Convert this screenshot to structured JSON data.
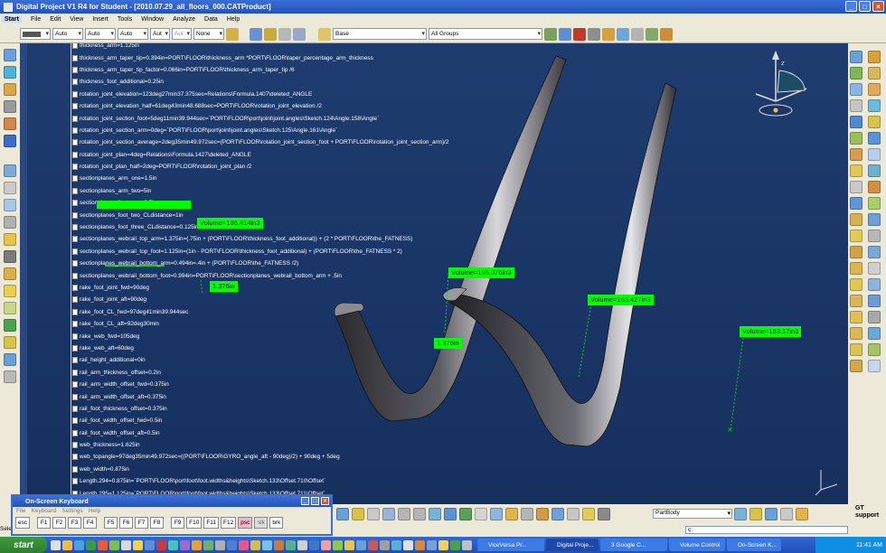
{
  "window": {
    "title": "Digital Project V1 R4 for Student - [2010.07.29_all_floors_000.CATProduct]"
  },
  "menu": [
    "Start",
    "File",
    "Edit",
    "View",
    "Insert",
    "Tools",
    "Window",
    "Analyze",
    "Data",
    "Help"
  ],
  "toolbar": {
    "selects": [
      "",
      "Auto",
      "Auto",
      "Auto",
      "Aut",
      "Aut",
      "None"
    ],
    "layer": "Base",
    "filter": "All Groups"
  },
  "tree_rows": [
    "thickness_arm=1.125in",
    "thickness_arm_taper_tip=0.394in=PORT\\FLOOR\\thickness_arm *PORT\\FLOOR\\taper_percentage_arm_thickness",
    "thickness_arm_taper_tip_factor=0.066in=PORT\\FLOOR\\thickness_arm_taper_tip /6",
    "thickness_foot_additional=0.25in",
    "rotation_joint_elevation=123deg27min37.375sec=Relations\\Formula.1407\\deleted_ANGLE",
    "rotation_joint_elevation_half=61deg43min48.688sec=PORT\\FLOOR\\rotation_joint_elevation /2",
    "rotation_joint_section_foot=5deg11min39.944sec=`PORT\\FLOOR\\port\\joint\\joint.angles\\Sketch.124\\Angle.158\\Angle`",
    "rotation_joint_section_arm=0deg=`PORT\\FLOOR\\port\\joint\\joint.angles\\Sketch.125\\Angle.161\\Angle`",
    "rotation_joint_section_average=2deg35min49.972sec=(PORT\\FLOOR\\rotation_joint_section_foot + PORT\\FLOOR\\rotation_joint_section_arm)/2",
    "rotation_joint_plan=4deg=Relations\\Formula.1427\\deleted_ANGLE",
    "rotation_joint_plan_half=2deg=PORT\\FLOOR\\rotation_joint_plan /2",
    "sectionplanes_arm_one=1.5in",
    "sectionplanes_arm_two=5in",
    "sectionplanes_foot_one=0.5in",
    "sectionplanes_foot_two_CLdistance=1in",
    "sectionplanes_foot_three_CLdistance=0.125in",
    "sectionplanes_webrail_top_arm=1.375in=(.75in + (PORT\\FLOOR\\thickness_foot_additional)) + (2 * PORT\\FLOOR\\the_FATNESS)",
    "sectionplanes_webrail_top_foot=1.125in=(1in - PORT\\FLOOR\\thickness_foot_additional) + (PORT\\FLOOR\\the_FATNESS * 2)",
    "sectionplanes_webrail_bottom_arm=0.494in=.4in + (PORT\\FLOOR\\the_FATNESS /2)",
    "sectionplanes_webrail_bottom_foot=0.994in=PORT\\FLOOR\\sectionplanes_webrail_bottom_arm + .5in",
    "rake_foot_joint_fwd=90deg",
    "rake_foot_joint_aft=90deg",
    "rake_foot_CL_fwd=97deg41min39.944sec",
    "rake_foot_CL_aft=92deg30min",
    "rake_web_fwd=105deg",
    "rake_web_aft=60deg",
    "rail_height_additional=0in",
    "rail_arm_thickness_offset=0.2in",
    "rail_arm_width_offset_fwd=0.375in",
    "rail_arm_width_offset_aft=0.375in",
    "rail_foot_thickness_offset=0.375in",
    "rail_foot_width_offset_fwd=0.5in",
    "rail_foot_width_offset_aft=0.5in",
    "web_thickness=1.625in",
    "web_topangle=97deg35min49.972sec=((PORT\\FLOOR\\GYRO_angle_aft - 90deg)/2) + 90deg + 5deg",
    "web_width=0.875in",
    "Length.294=0.875in=`PORT\\FLOOR\\port\\foot\\foot.widths&heights\\Sketch.133\\Offset.710\\Offset`",
    "Length.295=1.125in=`PORT\\FLOOR\\port\\foot\\foot.widths&heights\\Sketch.133\\Offset.711\\Offset`"
  ],
  "measurements": {
    "vol1": "Volume=186.414in3",
    "vol2": "Volume=195.076in3",
    "vol3": "Volume=163.427in3",
    "vol4": "Volume=163.17in3",
    "len1": "1.376in",
    "len2": "1.376in"
  },
  "osk": {
    "title": "On-Screen Keyboard",
    "menu": [
      "File",
      "Keyboard",
      "Settings",
      "Help"
    ],
    "keys": [
      "esc",
      "F1",
      "F2",
      "F3",
      "F4",
      "F5",
      "F6",
      "F7",
      "F8",
      "F9",
      "F10",
      "F11",
      "F12",
      "psc",
      "slk",
      "brk"
    ]
  },
  "status": {
    "select_label": "Sele",
    "partbody": "PartBody",
    "cmd_prefix": "c:",
    "gt_line1": "GT",
    "gt_line2": "support"
  },
  "taskbar": {
    "start": "start",
    "tasks": [
      "ViceVersa Pr...",
      "Digital Proje...",
      "3 Google C...",
      "Volume Control",
      "On-Screen K..."
    ],
    "clock": "11:41 AM"
  },
  "colors": {
    "viewport": "#1b3566",
    "measure": "#00ff00",
    "titlebar": "#2452b6"
  }
}
